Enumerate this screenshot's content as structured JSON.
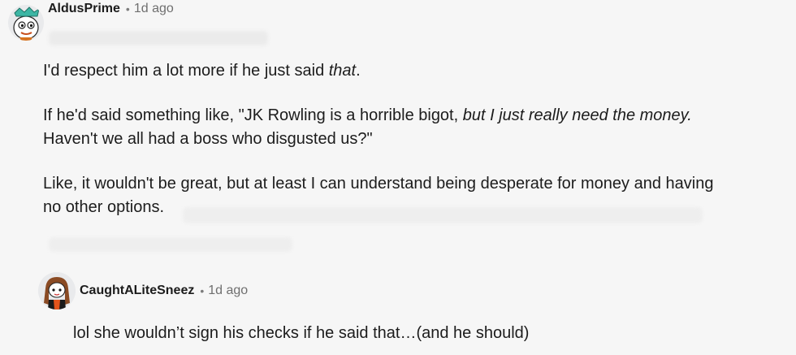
{
  "comments": [
    {
      "username": "AldusPrime",
      "time": "1d ago",
      "paragraphs": {
        "p1_plain": "I'd respect him a lot more if he just said ",
        "p1_italic": "that",
        "p1_end": ".",
        "p2_plain": "If he'd said something like, \"JK Rowling is a horrible bigot, ",
        "p2_italic": "but I just really need the money.",
        "p2_line2": "Haven't we all had a boss who disgusted us?\"",
        "p3_line1": "Like, it wouldn't be great, but at least I can understand being desperate for money and having",
        "p3_line2": "no other options."
      }
    },
    {
      "username": "CaughtALiteSneez",
      "time": "1d ago",
      "body": "lol she wouldn’t sign his checks if he said that…(and he should)"
    }
  ],
  "separator": "•"
}
